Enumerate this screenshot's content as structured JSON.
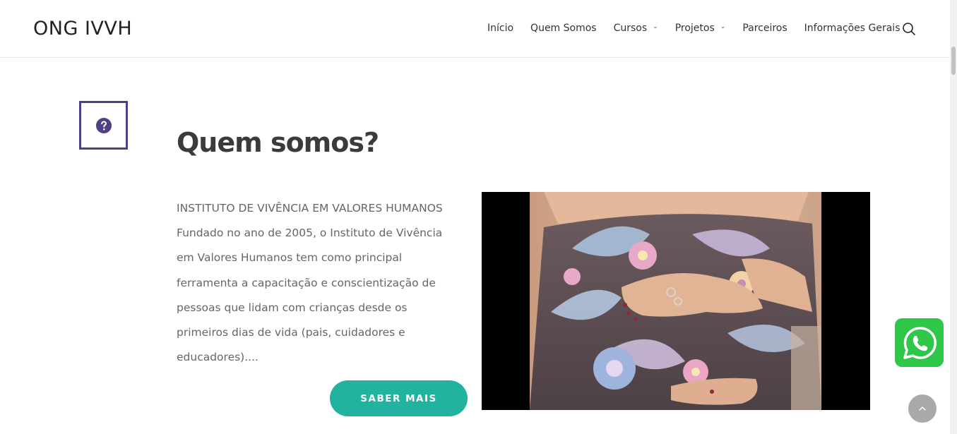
{
  "site": {
    "logo": "ONG IVVH"
  },
  "nav": {
    "items": [
      {
        "label": "Início",
        "has_dropdown": false
      },
      {
        "label": "Quem Somos",
        "has_dropdown": false
      },
      {
        "label": "Cursos",
        "has_dropdown": true
      },
      {
        "label": "Projetos",
        "has_dropdown": true
      },
      {
        "label": "Parceiros",
        "has_dropdown": false
      },
      {
        "label": "Informações Gerais",
        "has_dropdown": false
      }
    ],
    "search_icon": "search-icon"
  },
  "section": {
    "icon": "question-circle-icon",
    "title": "Quem somos?",
    "paragraph_lines": [
      "INSTITUTO DE VIVÊNCIA EM VALORES HUMANOS",
      "Fundado no ano de 2005, o Instituto de Vivência",
      "em Valores Humanos tem como principal",
      "ferramenta a capacitação e conscientização de",
      "pessoas que lidam com crianças desde os",
      "primeiros dias de vida (pais, cuidadores e",
      "educadores)...."
    ],
    "button_label": "SABER MAIS"
  },
  "floating": {
    "whatsapp_icon": "whatsapp-icon",
    "back_to_top_icon": "chevron-up-icon"
  },
  "colors": {
    "accent_purple": "#4f3f84",
    "button_teal": "#22b2a0",
    "whatsapp_green": "#2fc74a",
    "back_to_top_gray": "#a9a9a9"
  }
}
